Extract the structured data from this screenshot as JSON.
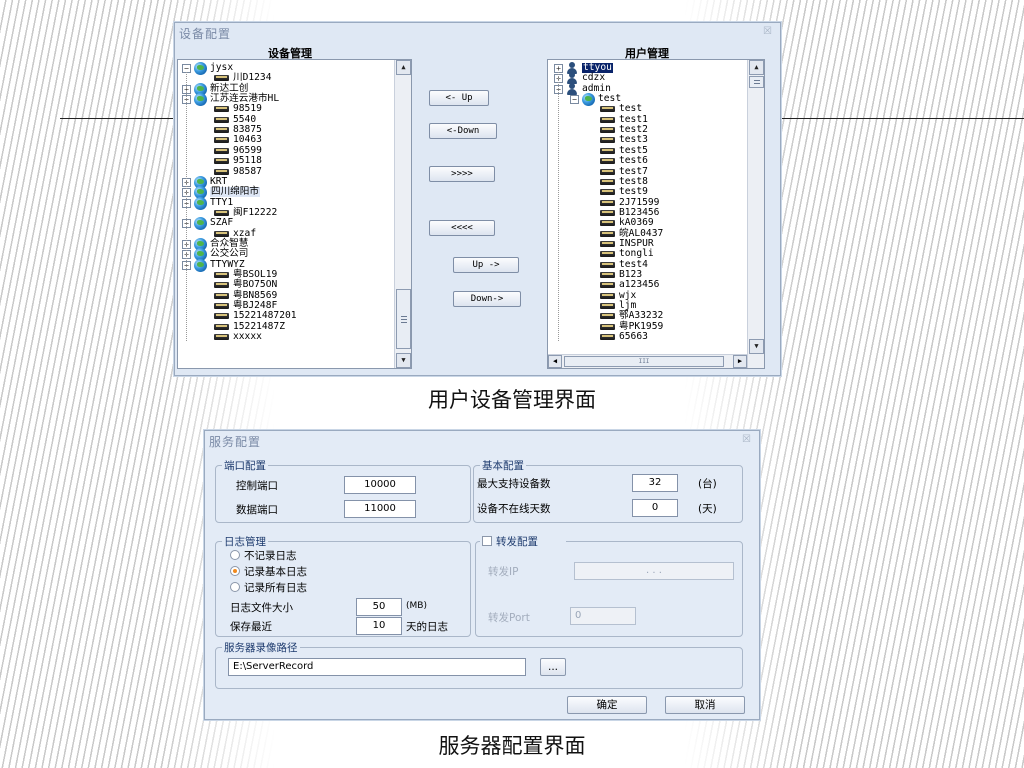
{
  "window1": {
    "title": "设备配置",
    "left_header": "设备管理",
    "right_header": "用户管理",
    "device_tree": [
      {
        "label": "jysx",
        "level": 0,
        "type": "group",
        "expander": "−"
      },
      {
        "label": "川D1234",
        "level": 1,
        "type": "device"
      },
      {
        "label": "新达工创",
        "level": 0,
        "type": "group",
        "expander": "+"
      },
      {
        "label": "江苏连云港市HL",
        "level": 0,
        "type": "group",
        "expander": "−"
      },
      {
        "label": "98519",
        "level": 1,
        "type": "device"
      },
      {
        "label": "5540",
        "level": 1,
        "type": "device"
      },
      {
        "label": "83875",
        "level": 1,
        "type": "device"
      },
      {
        "label": "10463",
        "level": 1,
        "type": "device"
      },
      {
        "label": "96599",
        "level": 1,
        "type": "device"
      },
      {
        "label": "95118",
        "level": 1,
        "type": "device"
      },
      {
        "label": "98587",
        "level": 1,
        "type": "device"
      },
      {
        "label": "KRT",
        "level": 0,
        "type": "group",
        "expander": "+"
      },
      {
        "label": "四川绵阳市",
        "level": 0,
        "type": "group",
        "expander": "+",
        "highlight": true
      },
      {
        "label": "TTY1",
        "level": 0,
        "type": "group",
        "expander": "−"
      },
      {
        "label": "闽F12222",
        "level": 1,
        "type": "device"
      },
      {
        "label": "SZAF",
        "level": 0,
        "type": "group",
        "expander": "−"
      },
      {
        "label": "xzaf",
        "level": 1,
        "type": "device"
      },
      {
        "label": "合众智慧",
        "level": 0,
        "type": "group",
        "expander": "+"
      },
      {
        "label": "公交公司",
        "level": 0,
        "type": "group",
        "expander": "+"
      },
      {
        "label": "TTYWYZ",
        "level": 0,
        "type": "group",
        "expander": "−"
      },
      {
        "label": "粤BSOL19",
        "level": 1,
        "type": "device"
      },
      {
        "label": "粤BO75ON",
        "level": 1,
        "type": "device"
      },
      {
        "label": "粤BN8569",
        "level": 1,
        "type": "device"
      },
      {
        "label": "粤BJ248F",
        "level": 1,
        "type": "device"
      },
      {
        "label": "15221487201",
        "level": 1,
        "type": "device"
      },
      {
        "label": "15221487Z",
        "level": 1,
        "type": "device"
      },
      {
        "label": "xxxxx",
        "level": 1,
        "type": "device"
      }
    ],
    "buttons": [
      "<- Up",
      "<-Down",
      ">>>>",
      "<<<<",
      "Up ->",
      "Down->"
    ],
    "user_tree": [
      {
        "label": "ttyou",
        "level": 0,
        "type": "user",
        "expander": "+",
        "selected": true
      },
      {
        "label": "cdzx",
        "level": 0,
        "type": "user",
        "expander": "+"
      },
      {
        "label": "admin",
        "level": 0,
        "type": "user",
        "expander": "−"
      },
      {
        "label": "test",
        "level": 1,
        "type": "group",
        "expander": "−"
      },
      {
        "label": "test",
        "level": 2,
        "type": "device"
      },
      {
        "label": "test1",
        "level": 2,
        "type": "device"
      },
      {
        "label": "test2",
        "level": 2,
        "type": "device"
      },
      {
        "label": "test3",
        "level": 2,
        "type": "device"
      },
      {
        "label": "test5",
        "level": 2,
        "type": "device"
      },
      {
        "label": "test6",
        "level": 2,
        "type": "device"
      },
      {
        "label": "test7",
        "level": 2,
        "type": "device"
      },
      {
        "label": "test8",
        "level": 2,
        "type": "device"
      },
      {
        "label": "test9",
        "level": 2,
        "type": "device"
      },
      {
        "label": "2J71599",
        "level": 2,
        "type": "device"
      },
      {
        "label": "B123456",
        "level": 2,
        "type": "device"
      },
      {
        "label": "kA0369",
        "level": 2,
        "type": "device"
      },
      {
        "label": "皖AL0437",
        "level": 2,
        "type": "device"
      },
      {
        "label": "INSPUR",
        "level": 2,
        "type": "device"
      },
      {
        "label": "tongli",
        "level": 2,
        "type": "device"
      },
      {
        "label": "test4",
        "level": 2,
        "type": "device"
      },
      {
        "label": "B123",
        "level": 2,
        "type": "device"
      },
      {
        "label": "a123456",
        "level": 2,
        "type": "device"
      },
      {
        "label": "wjx",
        "level": 2,
        "type": "device"
      },
      {
        "label": "ljm",
        "level": 2,
        "type": "device"
      },
      {
        "label": "鄂A33232",
        "level": 2,
        "type": "device"
      },
      {
        "label": "粤PK1959",
        "level": 2,
        "type": "device"
      },
      {
        "label": "65663",
        "level": 2,
        "type": "device"
      }
    ],
    "hscroll_thumb_text": "III"
  },
  "caption1": "用户设备管理界面",
  "window2": {
    "title": "服务配置",
    "port_group": {
      "title": "端口配置",
      "control_port_label": "控制端口",
      "control_port_value": "10000",
      "data_port_label": "数据端口",
      "data_port_value": "11000"
    },
    "basic_group": {
      "title": "基本配置",
      "max_devices_label": "最大支持设备数",
      "max_devices_value": "32",
      "max_devices_unit": "(台)",
      "offline_days_label": "设备不在线天数",
      "offline_days_value": "0",
      "offline_days_unit": "(天)"
    },
    "log_group": {
      "title": "日志管理",
      "options": [
        "不记录日志",
        "记录基本日志",
        "记录所有日志"
      ],
      "selected_index": 1,
      "file_size_label": "日志文件大小",
      "file_size_value": "50",
      "file_size_unit": "(MB)",
      "keep_label": "保存最近",
      "keep_value": "10",
      "keep_unit": "天的日志"
    },
    "forward_group": {
      "title": "转发配置",
      "checked": false,
      "ip_label": "转发IP",
      "ip_value": ".   .   .",
      "port_label": "转发Port",
      "port_value": "0"
    },
    "record_group": {
      "title": "服务器录像路径",
      "path_value": "E:\\ServerRecord",
      "browse_label": "..."
    },
    "ok_label": "确定",
    "cancel_label": "取消"
  },
  "caption2": "服务器配置界面",
  "icons": {
    "close": "close-icon",
    "group": "globe-icon",
    "user": "user-icon",
    "device": "device-icon"
  },
  "colors": {
    "window_bg": "#dfe8f4",
    "title_text": "#7a8aa6",
    "selection": "#0a246a",
    "radio_selected": "#f08a1f"
  }
}
